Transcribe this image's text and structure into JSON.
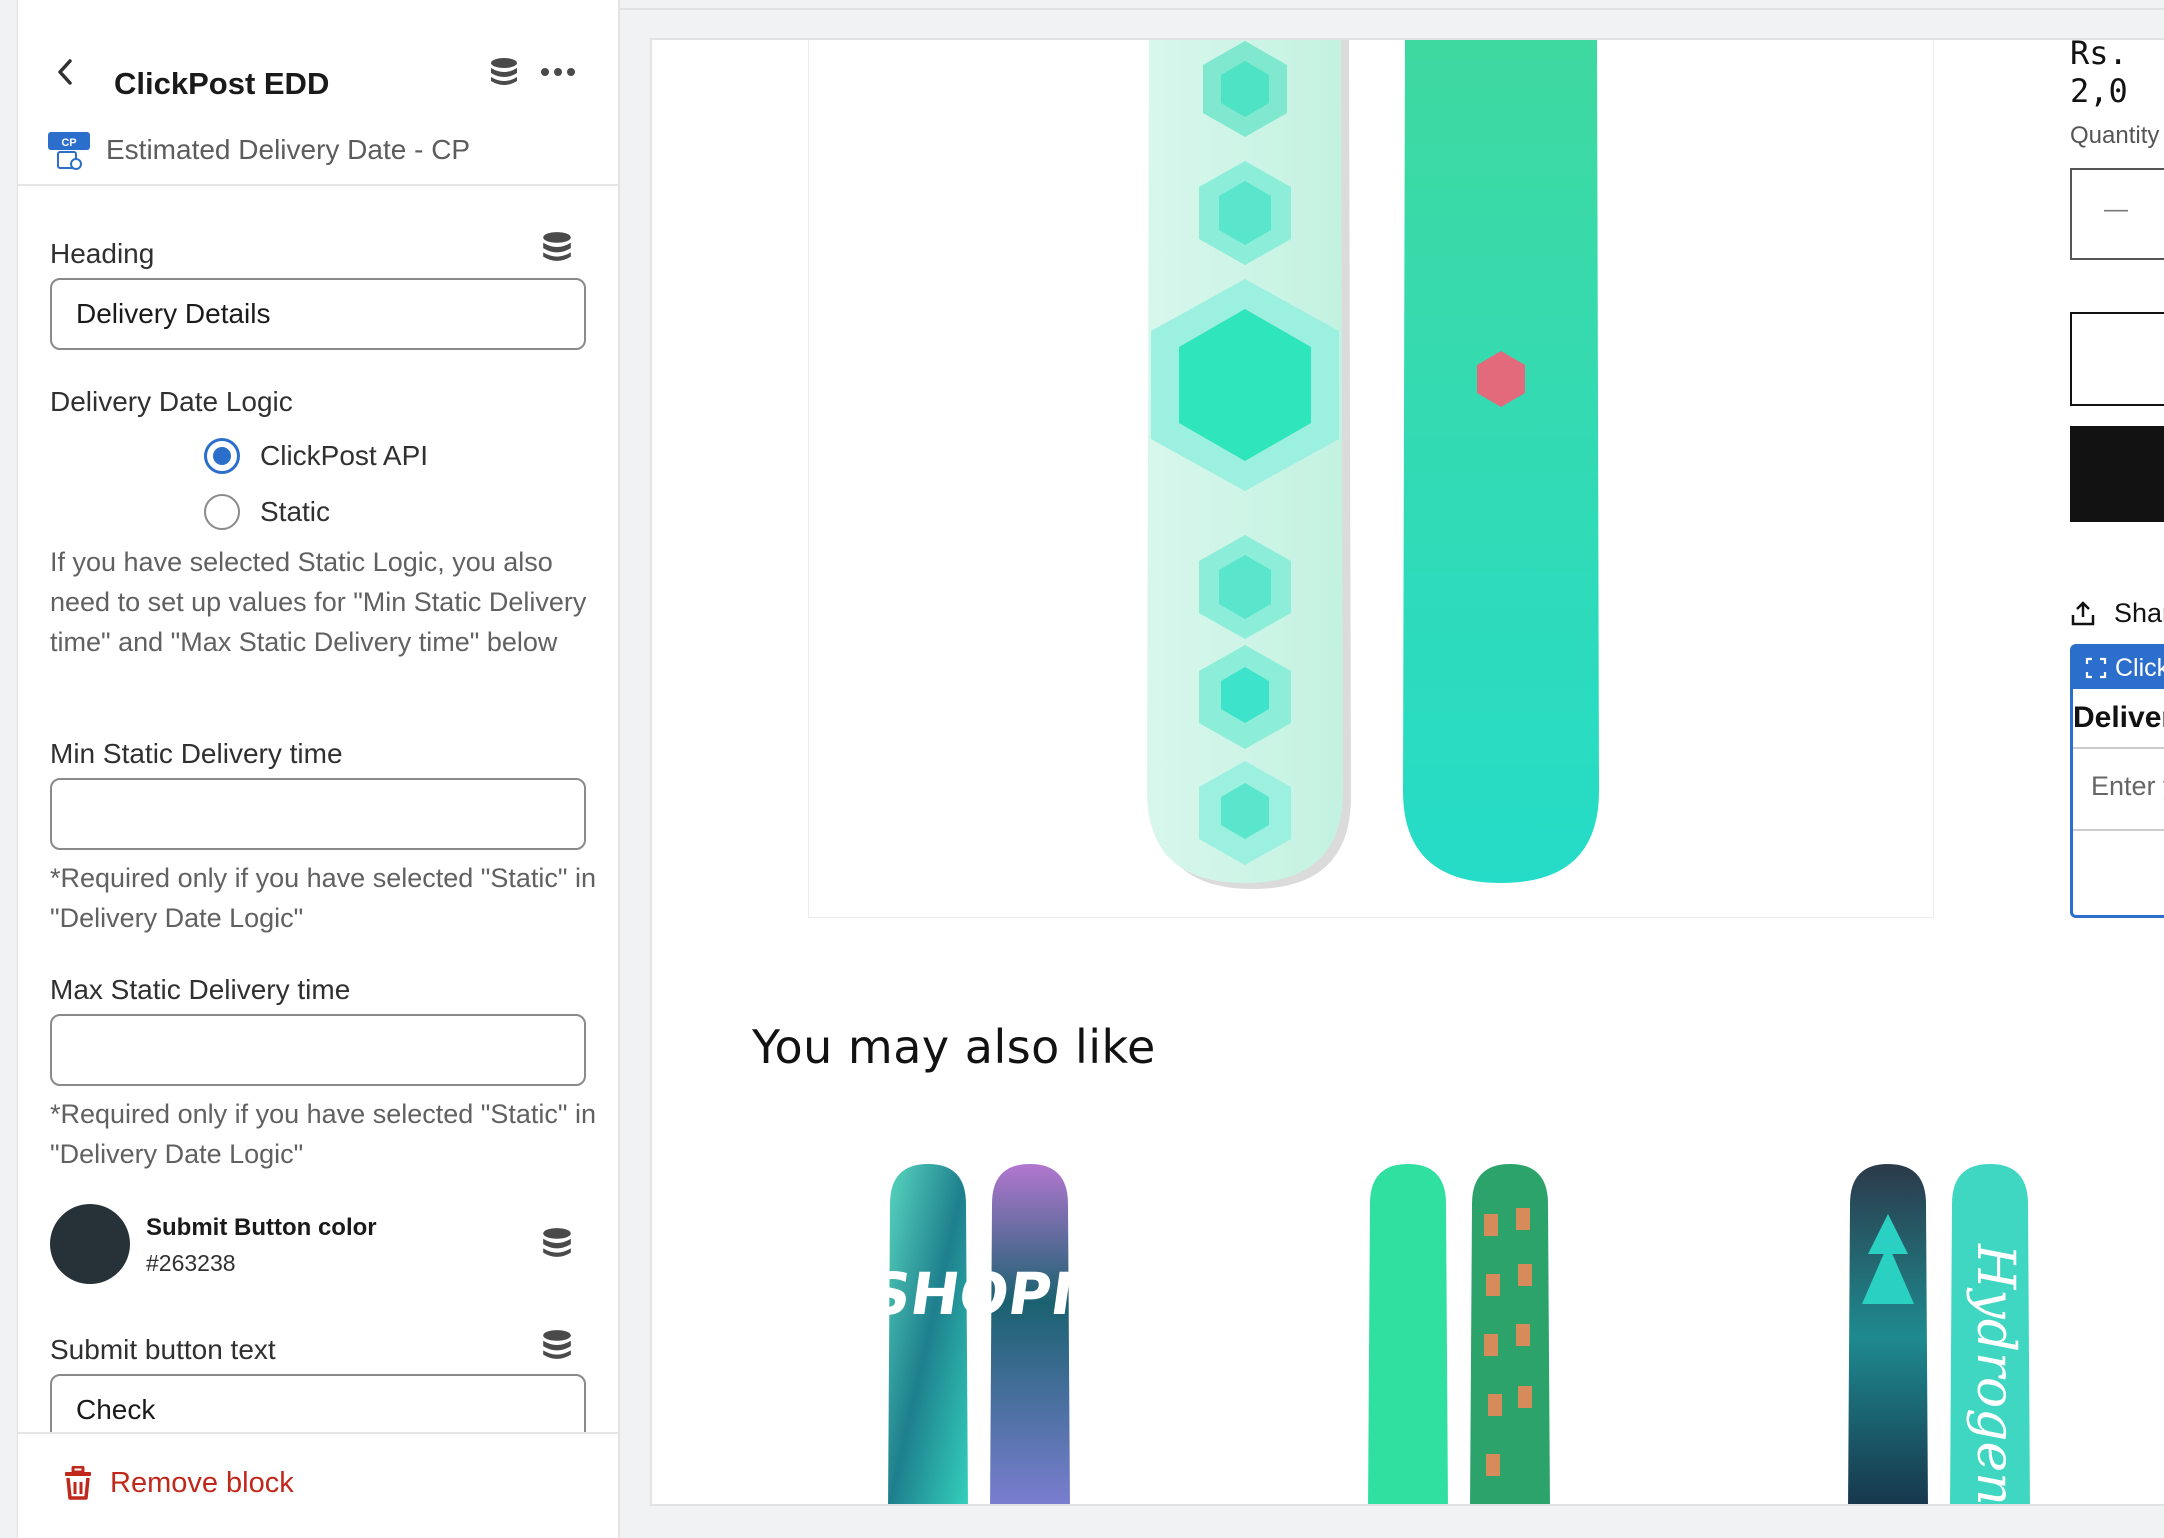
{
  "sidebar": {
    "app_title": "ClickPost EDD",
    "block_name": "Estimated Delivery Date - CP",
    "logo_text": "CP",
    "heading": {
      "label": "Heading",
      "value": "Delivery Details"
    },
    "logic": {
      "label": "Delivery Date Logic",
      "options": [
        {
          "label": "ClickPost API",
          "checked": true
        },
        {
          "label": "Static",
          "checked": false
        }
      ],
      "help": "If you have selected Static Logic, you also need to set up values for \"Min Static Delivery time\" and \"Max Static Delivery time\" below"
    },
    "min_static": {
      "label": "Min Static Delivery time",
      "value": "",
      "help": "*Required only if you have selected \"Static\" in \"Delivery Date Logic\""
    },
    "max_static": {
      "label": "Max Static Delivery time",
      "value": "",
      "help": "*Required only if you have selected \"Static\" in \"Delivery Date Logic\""
    },
    "submit_color": {
      "label": "Submit Button color",
      "hex": "#263238"
    },
    "submit_text": {
      "label": "Submit button text",
      "value": "Check"
    },
    "remove_label": "Remove block"
  },
  "preview": {
    "price": "Rs. 2,0",
    "quantity_label": "Quantity",
    "quantity_minus": "—",
    "share_label": "Shar",
    "cp_tag": "Click",
    "cp_heading": "Deliver",
    "cp_placeholder": "Enter y",
    "also_like": "You may also like",
    "recommend_text": [
      "SHOPIFY",
      "Hydrogen"
    ]
  },
  "colors": {
    "accent": "#2c6ecb",
    "danger": "#c0281b",
    "swatch": "#263238"
  }
}
